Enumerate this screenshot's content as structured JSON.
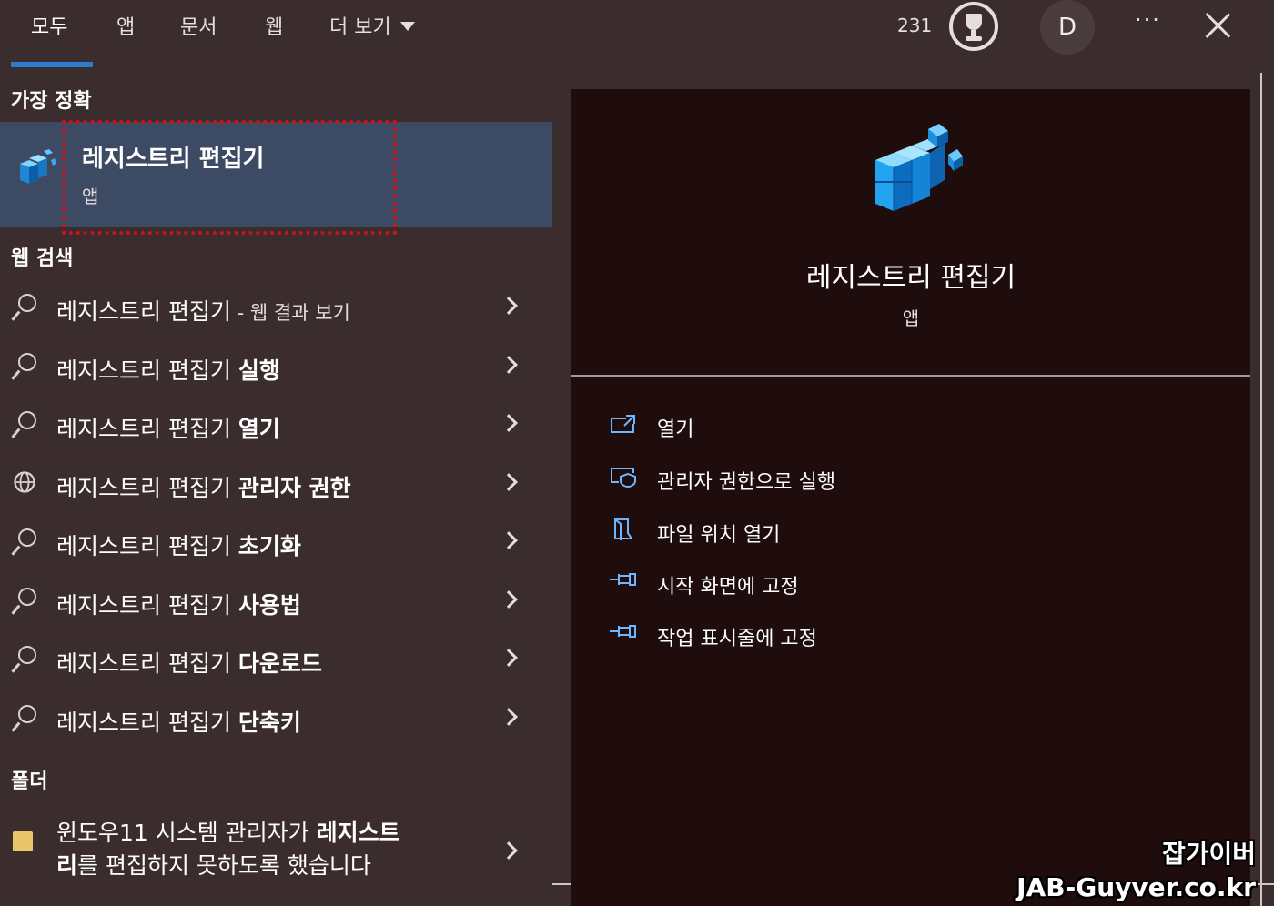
{
  "tabs": [
    {
      "label": "모두",
      "active": true
    },
    {
      "label": "앱"
    },
    {
      "label": "문서"
    },
    {
      "label": "웹"
    },
    {
      "label": "더 보기"
    }
  ],
  "header": {
    "points": "231",
    "avatar_letter": "D",
    "more_label": "···",
    "reward_icon": "trophy-icon",
    "close_icon": "close-icon"
  },
  "left": {
    "best_match_header": "가장 정확",
    "best_match": {
      "title": "레지스트리 편집기",
      "subtitle": "앱",
      "icon": "registry-editor-icon"
    },
    "web_header": "웹 검색",
    "web_results": [
      {
        "query": "레지스트리 편집기",
        "suffix": " - 웹 결과 보기",
        "icon": "search-icon"
      },
      {
        "query": "레지스트리 편집기 ",
        "bold": "실행",
        "icon": "search-icon"
      },
      {
        "query": "레지스트리 편집기 ",
        "bold": "열기",
        "icon": "search-icon"
      },
      {
        "query": "레지스트리 편집기 ",
        "bold": "관리자 권한",
        "icon": "globe-icon"
      },
      {
        "query": "레지스트리 편집기 ",
        "bold": "초기화",
        "icon": "search-icon"
      },
      {
        "query": "레지스트리 편집기 ",
        "bold": "사용법",
        "icon": "search-icon"
      },
      {
        "query": "레지스트리 편집기 ",
        "bold": "다운로드",
        "icon": "search-icon"
      },
      {
        "query": "레지스트리 편집기 ",
        "bold": "단축키",
        "icon": "search-icon"
      }
    ],
    "folder_header": "폴더",
    "folder_result": {
      "pre": "윈도우11 시스템 관리자가 ",
      "bold1": "레지스트",
      "bold2": "리",
      "post": "를 편집하지 못하도록 했습니다",
      "icon": "folder-icon"
    }
  },
  "preview": {
    "title": "레지스트리 편집기",
    "subtitle": "앱",
    "icon": "registry-editor-icon",
    "actions": [
      {
        "label": "열기",
        "icon": "open-icon"
      },
      {
        "label": "관리자 권한으로 실행",
        "icon": "shield-icon"
      },
      {
        "label": "파일 위치 열기",
        "icon": "file-location-icon"
      },
      {
        "label": "시작 화면에 고정",
        "icon": "pin-icon"
      },
      {
        "label": "작업 표시줄에 고정",
        "icon": "pin-icon"
      }
    ]
  },
  "watermark": {
    "line1": "잡가이버",
    "line2": "JAB-Guyver.co.kr"
  },
  "colors": {
    "background": "#3b2d2e",
    "best_match_bg": "#3c4b63",
    "preview_bg": "#1f0d0e",
    "accent": "#2b7bd1",
    "highlight_box": "#d0101a"
  }
}
